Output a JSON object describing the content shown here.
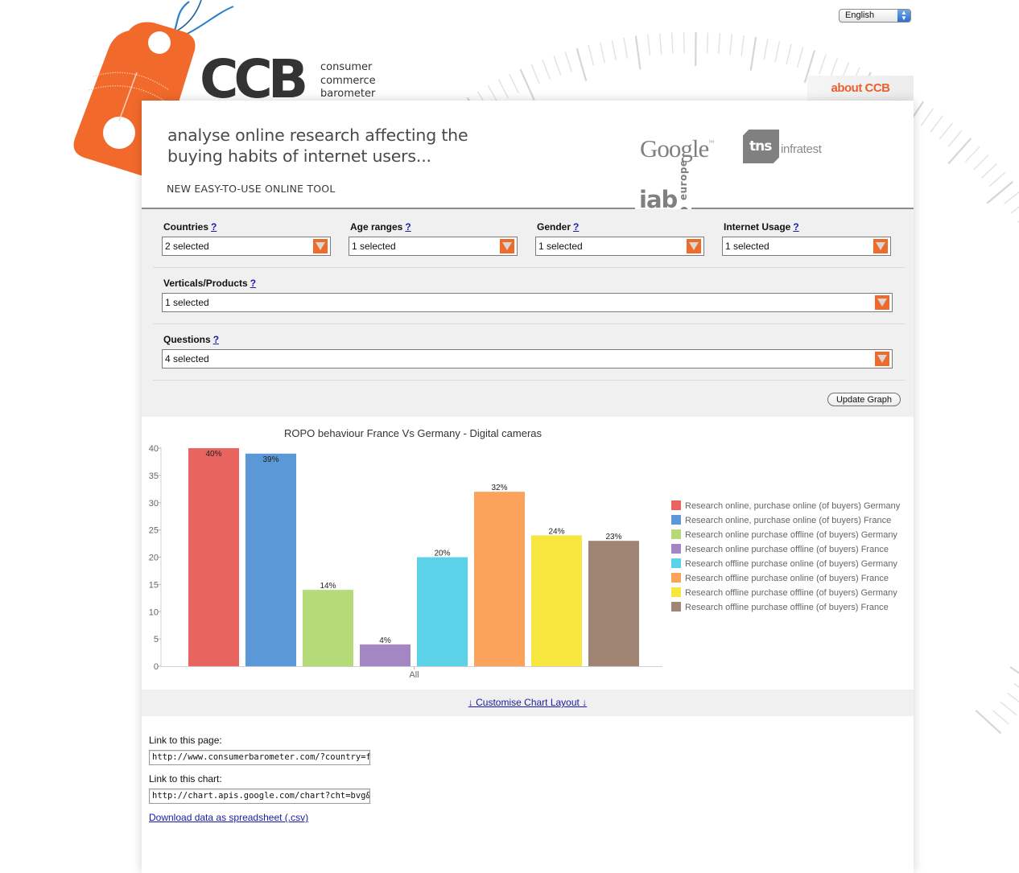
{
  "brand": {
    "logo": "CCB",
    "words": [
      "consumer",
      "commerce",
      "barometer"
    ],
    "accent": "#f06a2a"
  },
  "language_select": {
    "value": "English",
    "icon": "updown-arrows-icon"
  },
  "about_tab": {
    "label": "about CCB"
  },
  "header": {
    "headline_line1": "analyse online research affecting the",
    "headline_line2": "buying habits of internet users...",
    "subhead": "NEW EASY-TO-USE ONLINE TOOL",
    "partners": {
      "google": "Google",
      "google_tm": "™",
      "iab": "iab",
      "iab_europe": "europe",
      "tns": "tns",
      "tns_suffix": "infratest"
    }
  },
  "filters": {
    "help_label": "?",
    "countries": {
      "label": "Countries",
      "value": "2 selected"
    },
    "age_ranges": {
      "label": "Age ranges",
      "value": "1 selected"
    },
    "gender": {
      "label": "Gender",
      "value": "1 selected"
    },
    "internet_usage": {
      "label": "Internet Usage",
      "value": "1 selected"
    },
    "verticals": {
      "label": "Verticals/Products",
      "value": "1 selected"
    },
    "questions": {
      "label": "Questions",
      "value": "4 selected"
    },
    "update_button": "Update Graph"
  },
  "chart_data": {
    "type": "bar",
    "title": "ROPO behaviour France Vs Germany - Digital cameras",
    "categories": [
      "All"
    ],
    "xlabel": "",
    "ylabel": "",
    "ylim": [
      0,
      40
    ],
    "yticks": [
      0,
      5,
      10,
      15,
      20,
      25,
      30,
      35,
      40
    ],
    "grid": false,
    "legend_position": "right",
    "series": [
      {
        "name": "Research online, purchase online (of buyers) Germany",
        "values": [
          40
        ],
        "label": "40%",
        "color": "#e8655f"
      },
      {
        "name": "Research online, purchase online (of buyers) France",
        "values": [
          39
        ],
        "label": "39%",
        "color": "#5b98d7"
      },
      {
        "name": "Research online purchase offline (of buyers) Germany",
        "values": [
          14
        ],
        "label": "14%",
        "color": "#b4db77"
      },
      {
        "name": "Research online purchase offline (of buyers) France",
        "values": [
          4
        ],
        "label": "4%",
        "color": "#a386c3"
      },
      {
        "name": "Research offline purchase online (of buyers) Germany",
        "values": [
          20
        ],
        "label": "20%",
        "color": "#5bd2e8"
      },
      {
        "name": "Research offline purchase online (of buyers) France",
        "values": [
          32
        ],
        "label": "32%",
        "color": "#fca35b"
      },
      {
        "name": "Research offline purchase offline (of buyers) Germany",
        "values": [
          24
        ],
        "label": "24%",
        "color": "#f6e63e"
      },
      {
        "name": "Research offline purchase offline (of buyers) France",
        "values": [
          23
        ],
        "label": "23%",
        "color": "#a08575"
      }
    ]
  },
  "customise_link": "↓ Customise Chart Layout ↓",
  "links": {
    "page_label": "Link to this page:",
    "page_value": "http://www.consumerbarometer.com/?country=fr",
    "chart_label": "Link to this chart:",
    "chart_value": "http://chart.apis.google.com/chart?cht=bvg&chd=",
    "download": "Download data as spreadsheet (.csv)"
  }
}
